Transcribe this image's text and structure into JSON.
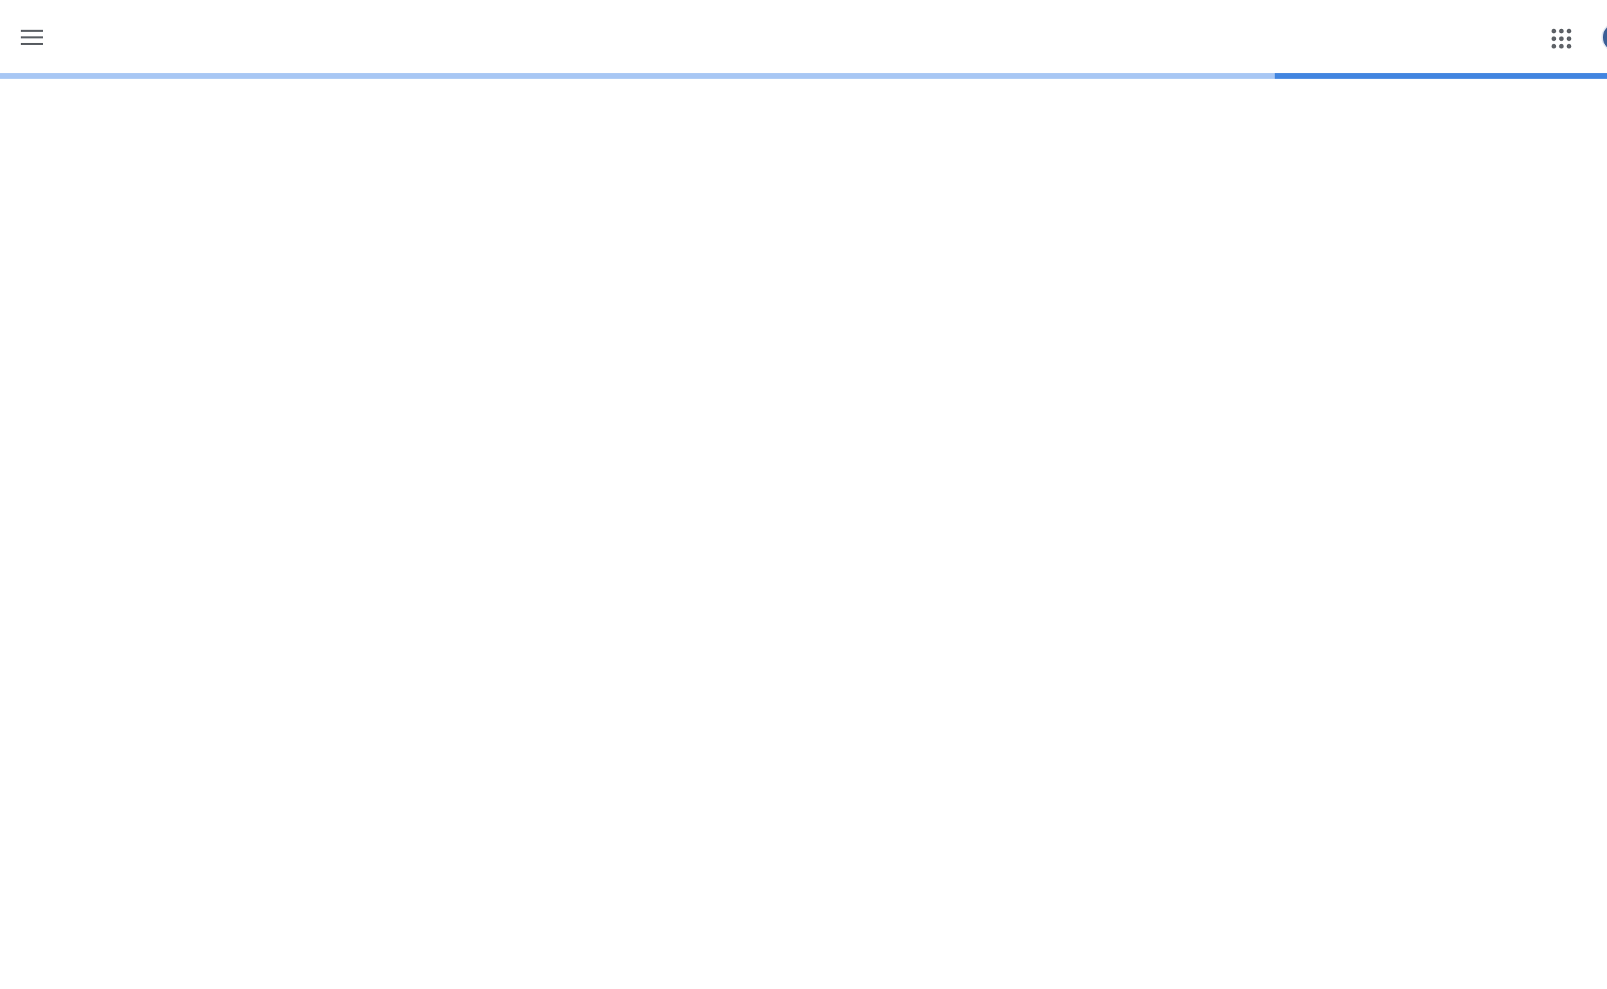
{
  "header": {
    "menu_icon": "hamburger-menu-icon",
    "apps_icon": "apps-grid-icon",
    "account_icon": "account-avatar"
  },
  "loading_bar": {
    "indeterminate": true,
    "track_color": "#a8c7f4",
    "bar_color": "#4285e0"
  },
  "colors": {
    "icon": "#5f6368",
    "background": "#ffffff"
  }
}
